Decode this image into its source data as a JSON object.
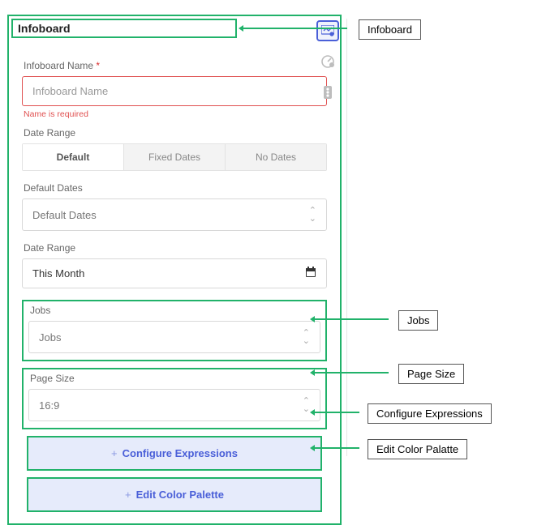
{
  "header": {
    "title": "Infoboard"
  },
  "infoboard_name": {
    "label": "Infoboard Name",
    "required_mark": "*",
    "placeholder": "Infoboard Name",
    "error": "Name is required"
  },
  "date_range_tabs": {
    "label": "Date Range",
    "items": [
      {
        "label": "Default",
        "active": true
      },
      {
        "label": "Fixed Dates",
        "active": false
      },
      {
        "label": "No Dates",
        "active": false
      }
    ]
  },
  "default_dates": {
    "label": "Default Dates",
    "value": "Default Dates"
  },
  "date_range_picker": {
    "label": "Date Range",
    "value": "This Month"
  },
  "jobs": {
    "label": "Jobs",
    "value": "Jobs"
  },
  "page_size": {
    "label": "Page Size",
    "value": "16:9"
  },
  "actions": {
    "configure": "Configure Expressions",
    "palette": "Edit Color Palette"
  },
  "side": {
    "infoboard_icon": "▤",
    "gauge_icon": "◔",
    "traffic_icon": "▮"
  },
  "callouts": {
    "infoboard": "Infoboard",
    "jobs": "Jobs",
    "page_size": "Page Size",
    "configure": "Configure Expressions",
    "palette": "Edit Color Palatte"
  }
}
